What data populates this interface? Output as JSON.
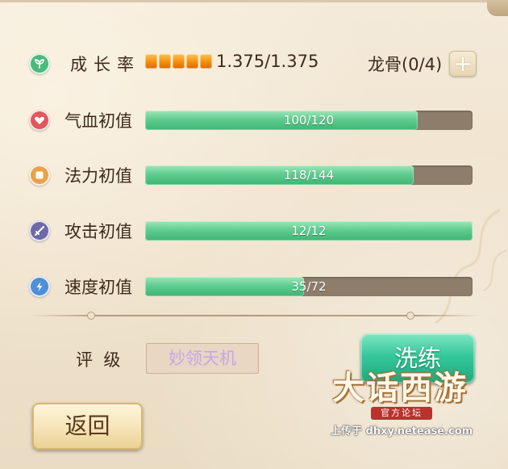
{
  "growth": {
    "label": "成长率",
    "value": "1.375/1.375",
    "pips_filled": 5,
    "pips_total": 5,
    "dragon_bone_label": "龙骨(0/4)",
    "plus_symbol": "+"
  },
  "stats": [
    {
      "label": "气血初值",
      "value_text": "100/120",
      "current": 100,
      "max": 120,
      "icon": "heart-icon",
      "icon_color": "#e2565c"
    },
    {
      "label": "法力初值",
      "value_text": "118/144",
      "current": 118,
      "max": 144,
      "icon": "scroll-icon",
      "icon_color": "#e9a24a"
    },
    {
      "label": "攻击初值",
      "value_text": "12/12",
      "current": 12,
      "max": 12,
      "icon": "sword-icon",
      "icon_color": "#6e6aa8"
    },
    {
      "label": "速度初值",
      "value_text": "35/72",
      "current": 35,
      "max": 72,
      "icon": "lightning-icon",
      "icon_color": "#4f8fd8"
    }
  ],
  "rating": {
    "label": "评  级",
    "value": "妙领天机"
  },
  "buttons": {
    "wash": "洗练",
    "back": "返回"
  },
  "watermark": {
    "logo_title": "大话西游",
    "logo_sub": "官方论坛",
    "text": "上传于 dhxy.netease.com"
  },
  "colors": {
    "bar_fill": "#5fcd90",
    "bar_track": "#8f7d6c",
    "pip": "#f18a0a",
    "rating_text": "#c8a6ea",
    "growth_icon": "#4bb978"
  }
}
